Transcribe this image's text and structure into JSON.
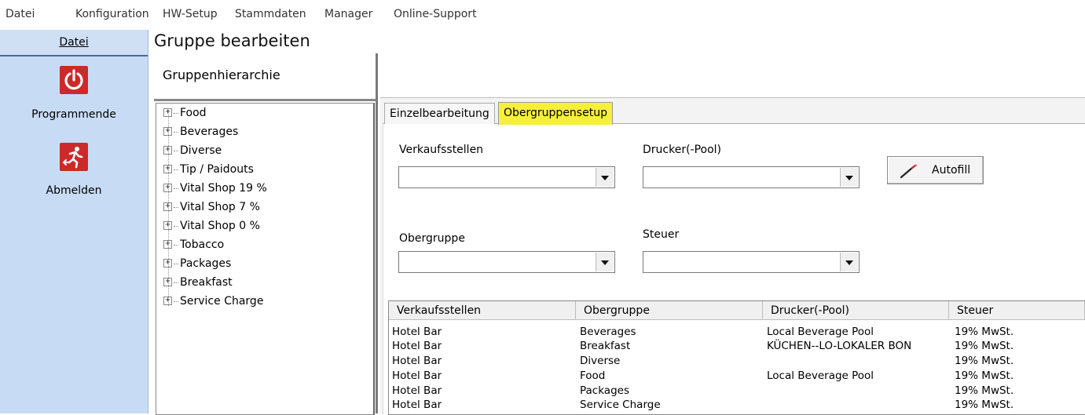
{
  "menubar": {
    "items": [
      "Datei",
      "Konfiguration",
      "HW-Setup",
      "Stammdaten",
      "Manager",
      "Online-Support"
    ]
  },
  "sidebar": {
    "header": "Datei",
    "items": [
      {
        "label": "Programmende",
        "icon": "power-icon"
      },
      {
        "label": "Abmelden",
        "icon": "exit-running-icon"
      }
    ],
    "accent_color": "#cc2a2a"
  },
  "page": {
    "title": "Gruppe bearbeiten"
  },
  "hierarchy": {
    "label": "Gruppenhierarchie",
    "items": [
      "Food",
      "Beverages",
      "Diverse",
      "Tip / Paidouts",
      "Vital Shop 19 %",
      "Vital Shop 7 %",
      "Vital Shop 0 %",
      "Tobacco",
      "Packages",
      "Breakfast",
      "Service Charge"
    ]
  },
  "tabs": [
    {
      "label": "Einzelbearbeitung",
      "active": false
    },
    {
      "label": "Obergruppensetup",
      "active": true,
      "color": "#f6ef3c"
    }
  ],
  "form": {
    "verkaufsstellen_label": "Verkaufsstellen",
    "drucker_label": "Drucker(-Pool)",
    "obergruppe_label": "Obergruppe",
    "steuer_label": "Steuer",
    "verkaufsstellen_value": "",
    "drucker_value": "",
    "obergruppe_value": "",
    "steuer_value": "",
    "autofill_label": "Autofill"
  },
  "table": {
    "columns": [
      "Verkaufsstellen",
      "Obergruppe",
      "Drucker(-Pool)",
      "Steuer"
    ],
    "rows": [
      [
        "Hotel Bar",
        "Beverages",
        "Local Beverage Pool",
        "19% MwSt."
      ],
      [
        "Hotel Bar",
        "Breakfast",
        "KÜCHEN--LO-LOKALER BON",
        "19% MwSt."
      ],
      [
        "Hotel Bar",
        "Diverse",
        "",
        "19% MwSt."
      ],
      [
        "Hotel Bar",
        "Food",
        "Local Beverage Pool",
        "19% MwSt."
      ],
      [
        "Hotel Bar",
        "Packages",
        "",
        "19% MwSt."
      ],
      [
        "Hotel Bar",
        "Service Charge",
        "",
        "19% MwSt."
      ]
    ]
  }
}
